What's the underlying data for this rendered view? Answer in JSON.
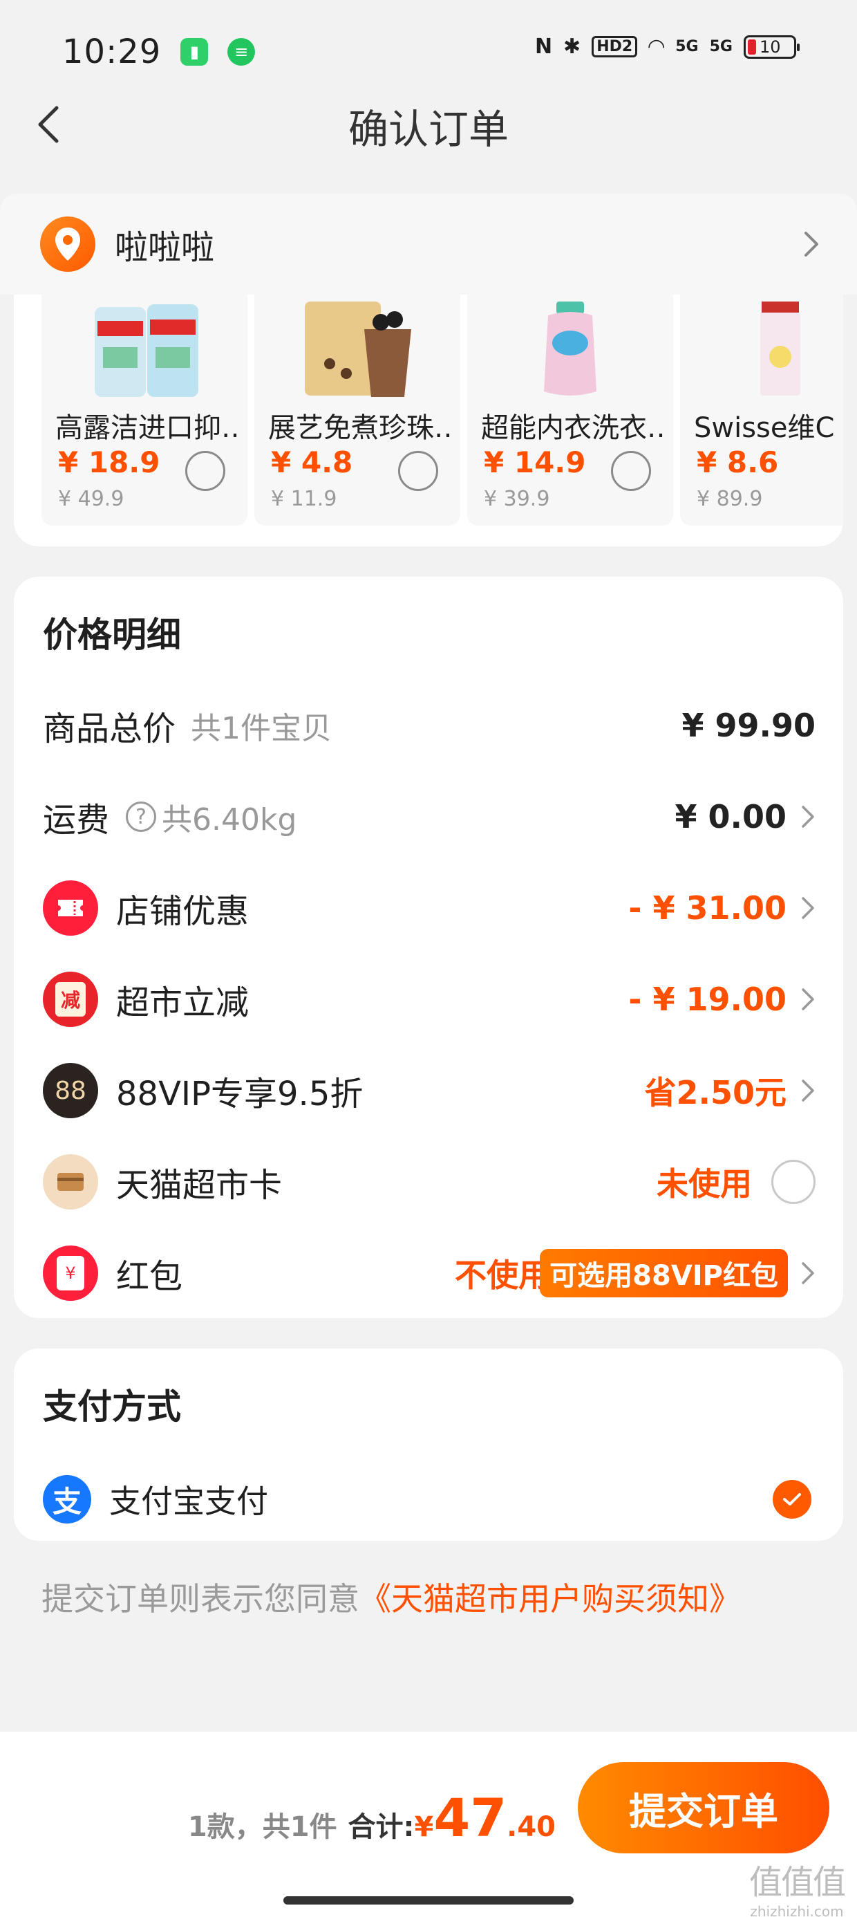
{
  "status_bar": {
    "time": "10:29",
    "indicators": [
      "N",
      "HD2",
      "5G",
      "5G"
    ],
    "battery": "10"
  },
  "header": {
    "title": "确认订单"
  },
  "address": {
    "name": "啦啦啦"
  },
  "products": [
    {
      "name": "高露洁进口抑…",
      "price": "¥ 18.9",
      "original": "¥ 49.9"
    },
    {
      "name": "展艺免煮珍珠…",
      "price": "¥ 4.8",
      "original": "¥ 11.9"
    },
    {
      "name": "超能内衣洗衣…",
      "price": "¥ 14.9",
      "original": "¥ 39.9"
    },
    {
      "name": "Swisse维C",
      "price": "¥ 8.6",
      "original": "¥ 89.9"
    }
  ],
  "price_details": {
    "title": "价格明细",
    "goods_total": {
      "label": "商品总价",
      "sub": "共1件宝贝",
      "value": "¥ 99.90"
    },
    "shipping": {
      "label": "运费",
      "weight": "共6.40kg",
      "value": "¥ 0.00"
    },
    "shop_discount": {
      "label": "店铺优惠",
      "value": "- ¥ 31.00"
    },
    "market_discount": {
      "label": "超市立减",
      "icon_text": "减",
      "value": "- ¥ 19.00"
    },
    "vip": {
      "label": "88VIP专享9.5折",
      "icon_text": "88",
      "value": "省2.50元"
    },
    "market_card": {
      "label": "天猫超市卡",
      "value": "未使用"
    },
    "red_packet": {
      "label": "红包",
      "icon_text": "¥",
      "value": "不使用",
      "badge": "可选用88VIP红包"
    }
  },
  "payment": {
    "title": "支付方式",
    "method": "支付宝支付",
    "method_icon": "支"
  },
  "agreement": {
    "text": "提交订单则表示您同意",
    "link": "《天猫超市用户购买须知》"
  },
  "bottom": {
    "count": "1款，共1件",
    "total_label": "合计:",
    "currency": "¥",
    "total_int": "47",
    "total_dec": ".40",
    "submit": "提交订单",
    "watermark": "值值值",
    "watermark_url": "zhizhizhi.com"
  }
}
